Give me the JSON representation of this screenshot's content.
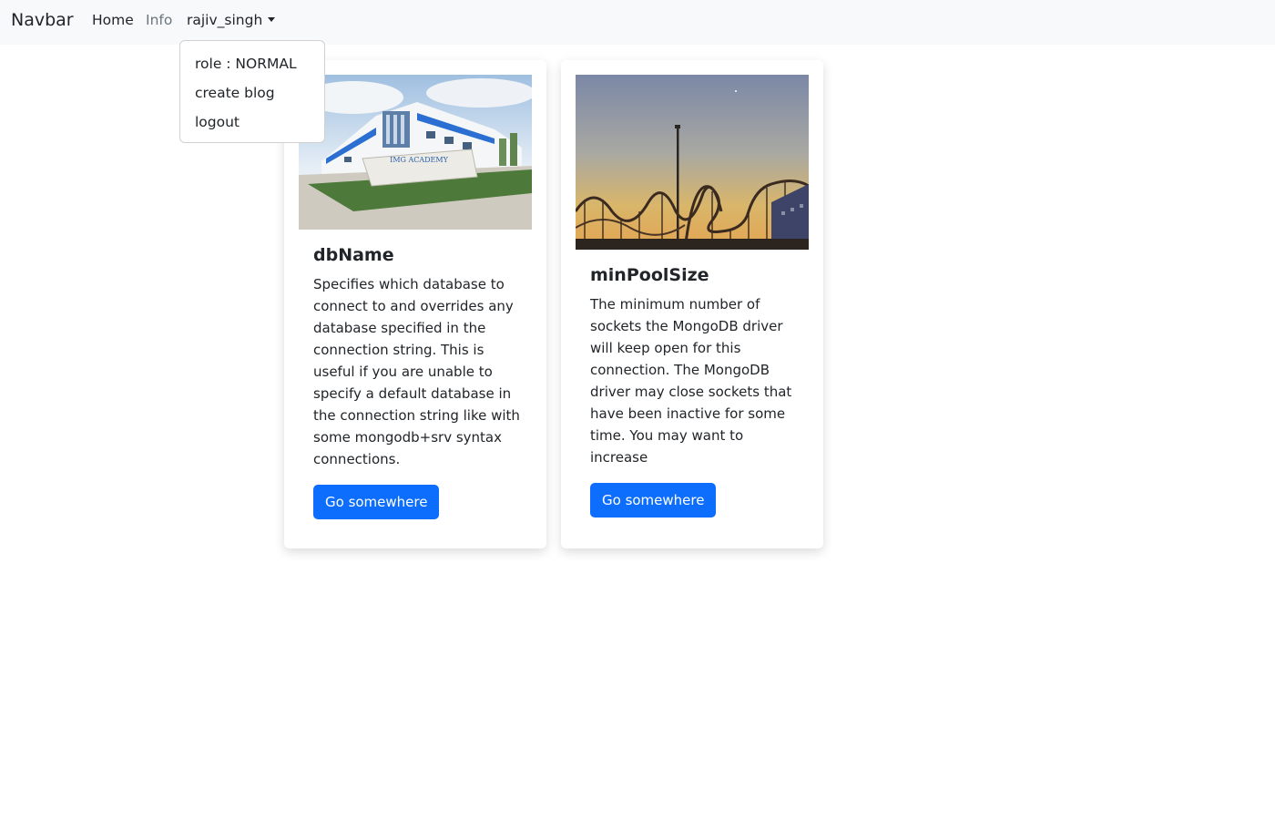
{
  "navbar": {
    "brand": "Navbar",
    "home_label": "Home",
    "info_label": "Info",
    "user_label": "rajiv_singh"
  },
  "dropdown": {
    "items": [
      {
        "label": "role : NORMAL"
      },
      {
        "label": "create blog"
      },
      {
        "label": "logout"
      }
    ]
  },
  "cards": [
    {
      "title": "dbName",
      "text": "Specifies which database to connect to and overrides any database specified in the connection string. This is useful if you are unable to specify a default database in the connection string like with some mongodb+srv syntax connections.",
      "button_label": "Go somewhere",
      "image_alt": "IMG Academy building photo",
      "image_sign": "IMG ACADEMY"
    },
    {
      "title": "minPoolSize",
      "text": "The minimum number of sockets the MongoDB driver will keep open for this connection. The MongoDB driver may close sockets that have been inactive for some time. You may want to increase",
      "button_label": "Go somewhere",
      "image_alt": "roller coaster at sunset photo"
    }
  ],
  "colors": {
    "primary": "#0d6efd",
    "navbar_bg": "#f8f9fa",
    "muted_link": "#6c757d"
  }
}
